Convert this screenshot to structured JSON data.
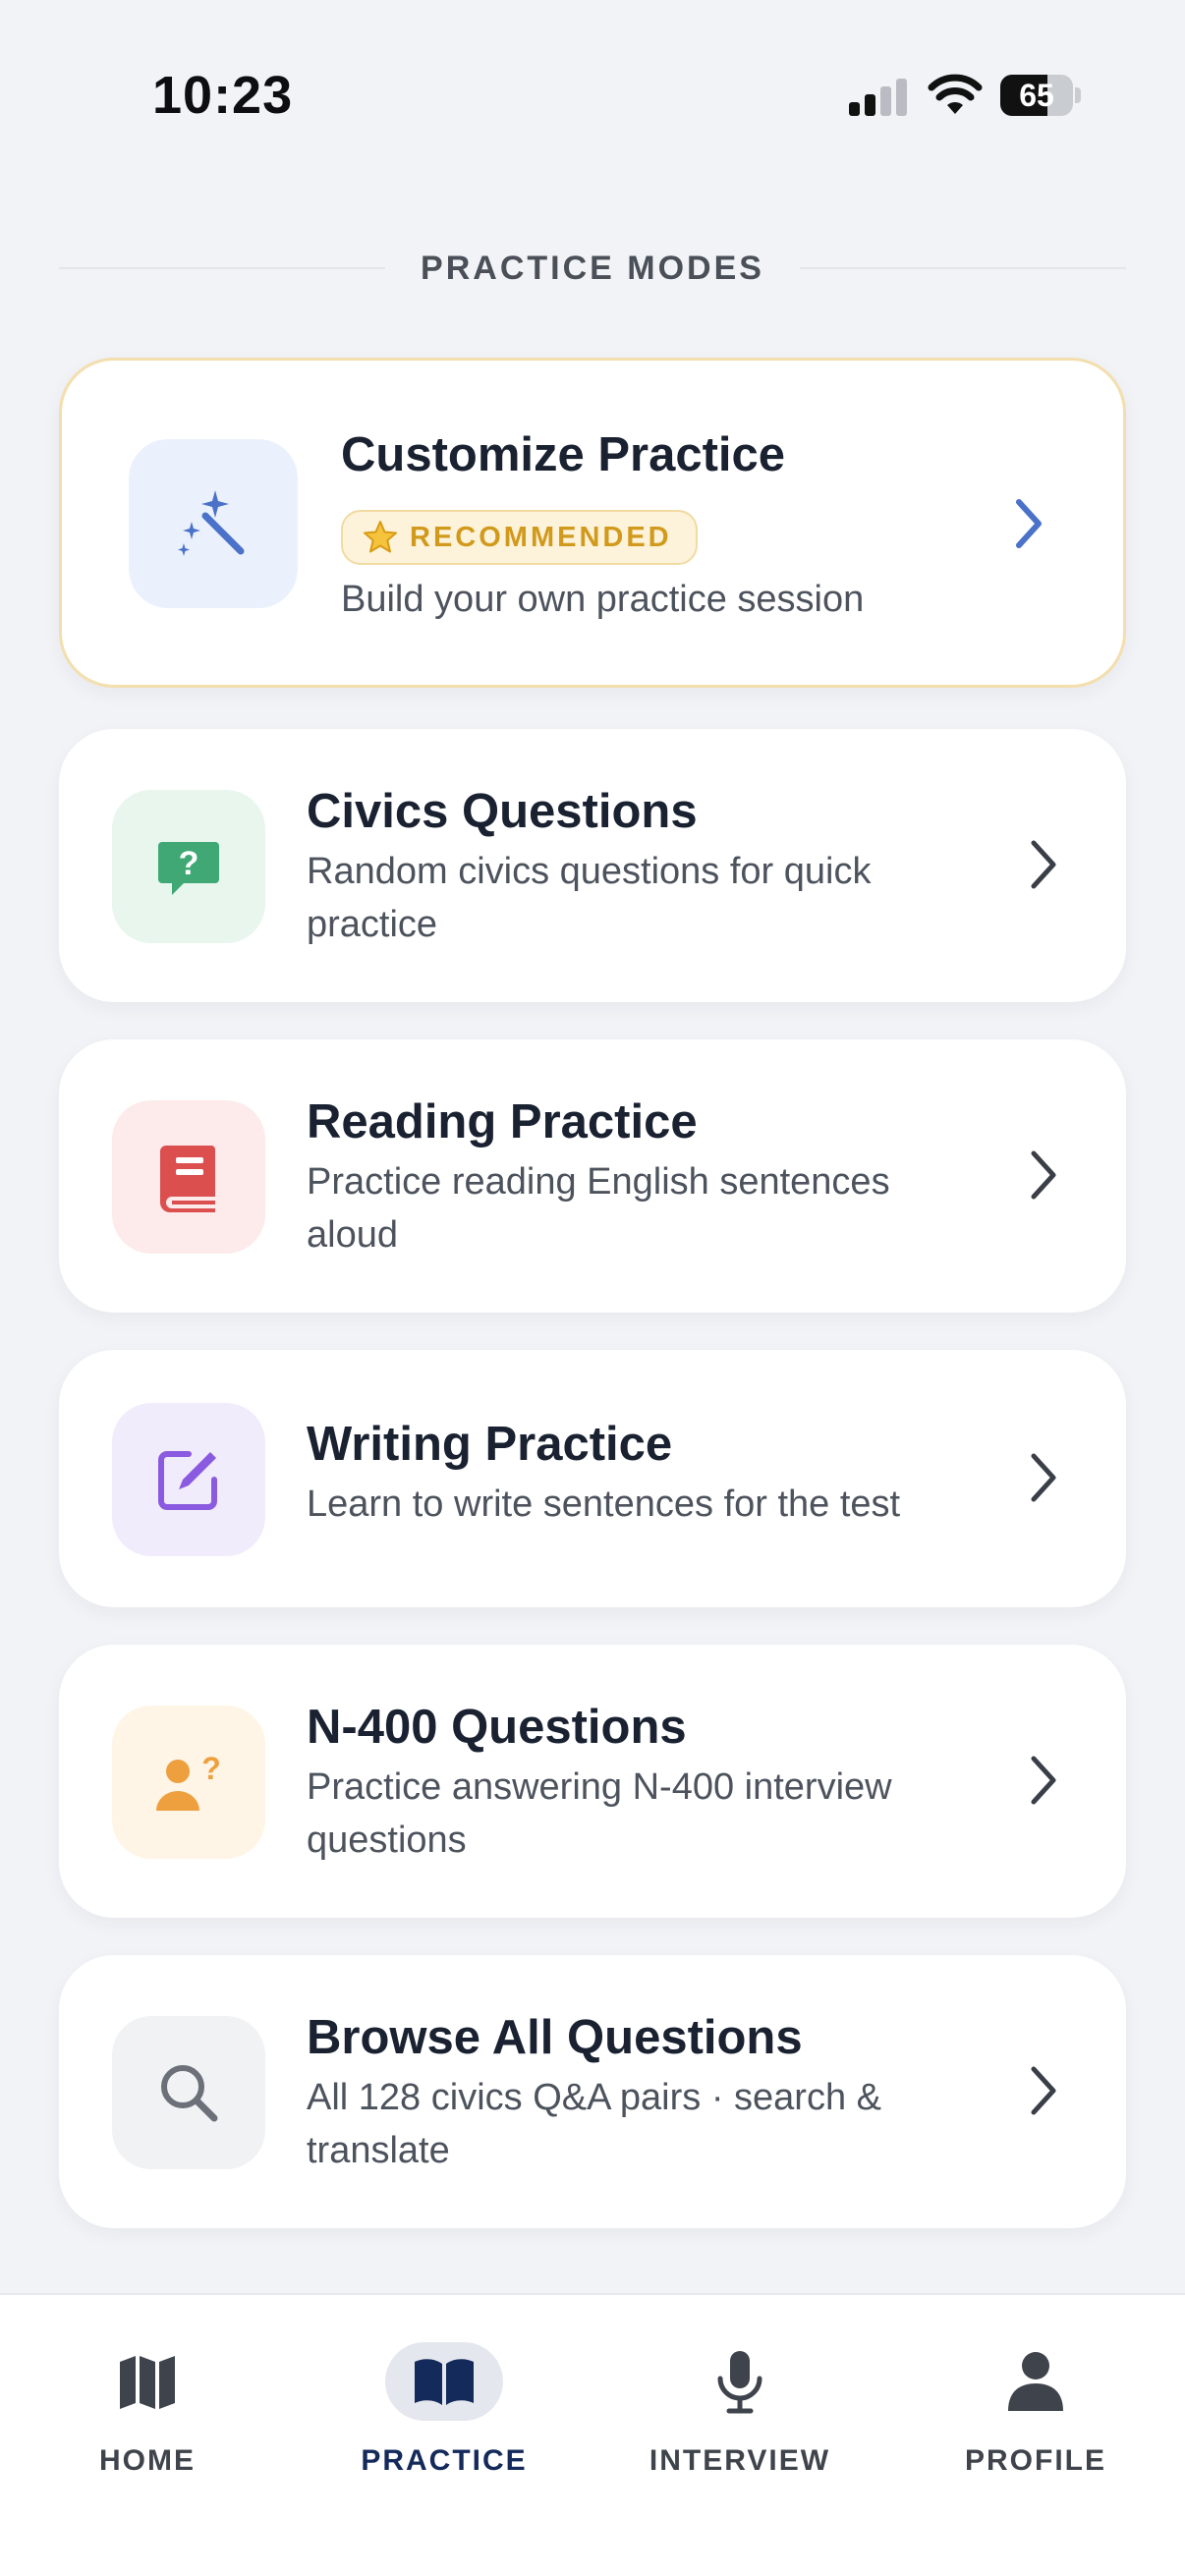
{
  "status_bar": {
    "time": "10:23",
    "battery": "65",
    "battery_level": 0.65
  },
  "section": {
    "title": "PRACTICE MODES"
  },
  "cards": [
    {
      "title": "Customize Practice",
      "badge": "RECOMMENDED",
      "subtitle": "Build your own practice session",
      "icon": "magic-wand-icon",
      "color": "#4a72c9"
    },
    {
      "title": "Civics Questions",
      "subtitle_line1": "Random civics questions for quick",
      "subtitle_line2": "practice",
      "icon": "question-bubble-icon",
      "color": "#3fa874"
    },
    {
      "title": "Reading Practice",
      "subtitle_line1": "Practice reading English sentences",
      "subtitle_line2": "aloud",
      "icon": "book-icon",
      "color": "#db4f4f"
    },
    {
      "title": "Writing Practice",
      "subtitle": "Learn to write sentences for the test",
      "icon": "edit-icon",
      "color": "#8a5ae0"
    },
    {
      "title": "N-400 Questions",
      "subtitle_line1": "Practice answering N-400 interview",
      "subtitle_line2": "questions",
      "icon": "person-question-icon",
      "color": "#eea03e"
    },
    {
      "title": "Browse All Questions",
      "subtitle_line1": "All 128 civics Q&A pairs · search &",
      "subtitle_line2": "translate",
      "icon": "search-icon",
      "color": "#6b7079"
    }
  ],
  "nav": {
    "items": [
      {
        "label": "HOME",
        "icon": "map-icon"
      },
      {
        "label": "PRACTICE",
        "icon": "open-book-icon",
        "active": true
      },
      {
        "label": "INTERVIEW",
        "icon": "microphone-icon"
      },
      {
        "label": "PROFILE",
        "icon": "person-icon"
      }
    ]
  }
}
